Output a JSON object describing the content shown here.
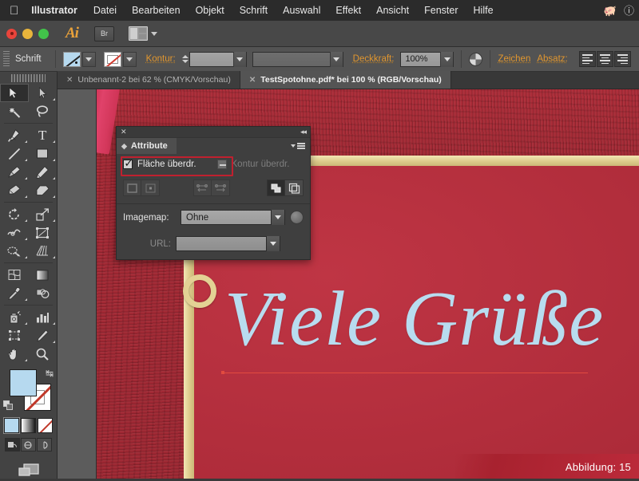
{
  "menubar": {
    "apple_icon": "apple-icon",
    "app_name": "Illustrator",
    "items": [
      "Datei",
      "Bearbeiten",
      "Objekt",
      "Schrift",
      "Auswahl",
      "Effekt",
      "Ansicht",
      "Fenster",
      "Hilfe"
    ],
    "tray": [
      "evernote-icon",
      "info-icon"
    ]
  },
  "appbar": {
    "logo": "Ai",
    "bridge_label": "Br",
    "arrange_icon": "arrange-documents-icon"
  },
  "control_panel": {
    "context_label": "Schrift",
    "fill_swatch": "fill-swatch",
    "stroke_swatch": "stroke-swatch-none",
    "stroke_label": "Kontur:",
    "stroke_weight": "",
    "stroke_profile": "",
    "opacity_label": "Deckkraft:",
    "opacity_value": "100%",
    "blend_icon": "blend-mode-icon",
    "character_label": "Zeichen",
    "paragraph_label": "Absatz:",
    "align_buttons": [
      "align-left",
      "align-center",
      "align-right"
    ]
  },
  "tabs": [
    {
      "title": "Unbenannt-2 bei 62 % (CMYK/Vorschau)",
      "active": false
    },
    {
      "title": "TestSpotohne.pdf* bei 100 % (RGB/Vorschau)",
      "active": true
    }
  ],
  "toolbar": {
    "tools": [
      "selection-tool",
      "direct-selection-tool",
      "magic-wand-tool",
      "lasso-tool",
      "pen-tool",
      "type-tool",
      "line-segment-tool",
      "rectangle-tool",
      "paintbrush-tool",
      "pencil-tool",
      "blob-brush-tool",
      "eraser-tool",
      "rotate-tool",
      "scale-tool",
      "width-tool",
      "free-transform-tool",
      "shape-builder-tool",
      "perspective-grid-tool",
      "mesh-tool",
      "gradient-tool",
      "eyedropper-tool",
      "blend-tool",
      "symbol-sprayer-tool",
      "column-graph-tool",
      "artboard-tool",
      "slice-tool",
      "hand-tool",
      "zoom-tool"
    ],
    "active_tool": "selection-tool",
    "fill_color": "#b6d9ef",
    "stroke_color": "none",
    "swap_icon": "swap-fill-stroke-icon",
    "default_icon": "default-fill-stroke-icon",
    "fill_modes": [
      "color-mode",
      "gradient-mode",
      "none-mode"
    ],
    "screen_modes": [
      "normal-screen-mode",
      "full-screen-menu-mode",
      "full-screen-mode"
    ],
    "change_screen_icon": "change-screen-mode-icon"
  },
  "attribute_panel": {
    "close_icon": "close-icon",
    "collapse_icon": "collapse-panel-icon",
    "tab_title": "Attribute",
    "menu_icon": "panel-menu-icon",
    "overprint_fill_label": "Fläche überdr.",
    "overprint_fill_checked": true,
    "overprint_stroke_label": "Kontur überdr.",
    "overprint_stroke_state": "mixed",
    "highlight_color": "#c0202f",
    "button_icons": [
      "show-center-icon",
      "hide-center-icon",
      "reverse-path-direction-off-icon",
      "reverse-path-direction-on-icon",
      "dont-show-center-icon",
      "show-overlap-icon"
    ],
    "imagemap_label": "Imagemap:",
    "imagemap_value": "Ohne",
    "browser_preview_icon": "browser-preview-icon",
    "url_label": "URL:",
    "url_value": ""
  },
  "canvas": {
    "headline": "Viele Grüße",
    "headline_color": "#b8dcef",
    "background_color": "#b42f3e",
    "gold_border_color": "#ddcb8c",
    "ribbon_color": "#e0426a",
    "ring_icon": "eyelet-ring",
    "baseline_color": "#e24b3f",
    "caption": "Abbildung: 15"
  }
}
